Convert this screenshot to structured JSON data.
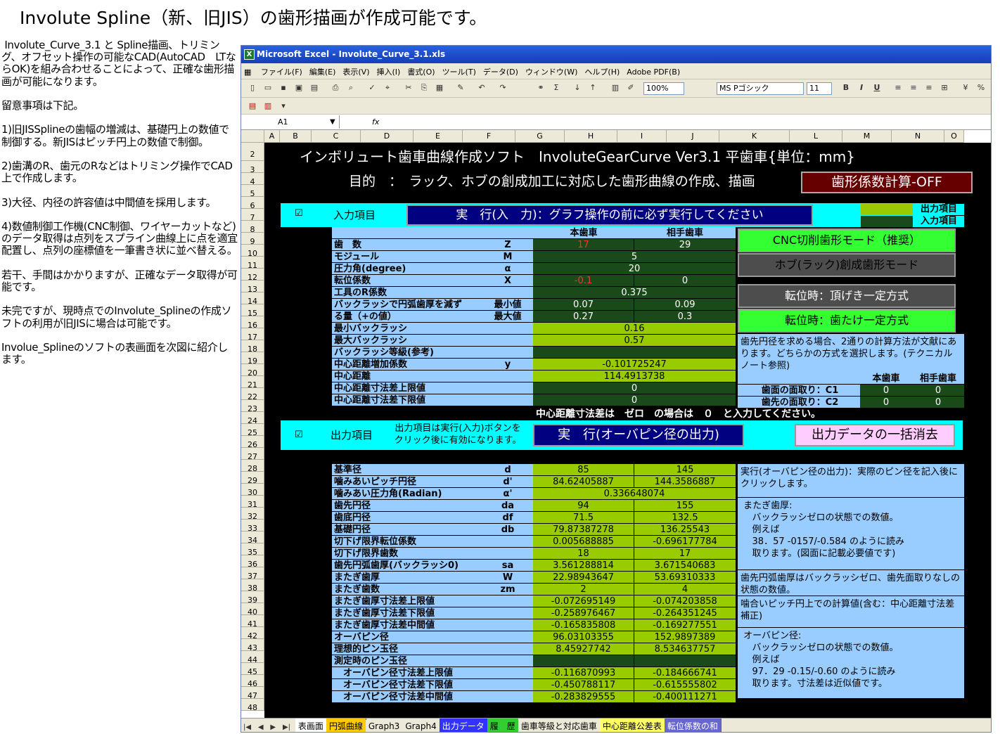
{
  "heading": "Involute Spline（新、旧JIS）の歯形描画が作成可能です。",
  "description": " Involute_Curve_3.1 と Spline描画、トリミング、オフセット操作の可能なCAD(AutoCAD　LTならOK)を組み合わせることによって、正確な歯形描画が可能になります。\n\n留意事項は下記。\n\n1)旧JISSplineの歯幅の増減は、基礎円上の数値で制御する。新JISはピッチ円上の数値で制御。\n\n2)歯溝のR、歯元のRなどはトリミング操作でCAD上で作成します。\n\n3)大径、内径の許容値は中間値を採用します。\n\n4)数値制御工作機(CNC制御、ワイヤーカットなど)のデータ取得は点列をスプライン曲線上に点を適宜配置し、点列の座標値を一筆書き状に並べ替える。\n\n若干、手間はかかりますが、正確なデータ取得が可能です。\n\n未完ですが、現時点でのInvolute_Splineの作成ソフトの利用が旧JISに場合は可能です。\n\nInvolue_Splineのソフトの表画面を次図に紹介します。",
  "window": {
    "title": "Microsoft Excel - Involute_Curve_3.1.xls",
    "menu": [
      "ファイル(F)",
      "編集(E)",
      "表示(V)",
      "挿入(I)",
      "書式(O)",
      "ツール(T)",
      "データ(D)",
      "ウィンドウ(W)",
      "ヘルプ(H)",
      "Adobe PDF(B)"
    ],
    "zoom": "100%",
    "font_name": "MS Pゴシック",
    "font_size": "11",
    "name_box": "A1",
    "fx": "fx"
  },
  "columns": [
    "A",
    "B",
    "C",
    "D",
    "E",
    "F",
    "G",
    "H",
    "I",
    "J",
    "K",
    "L",
    "M",
    "N",
    "O"
  ],
  "rows": [
    "2",
    "3",
    "4",
    "5",
    "6",
    "7",
    "8",
    "9",
    "10",
    "11",
    "12",
    "13",
    "14",
    "15",
    "16",
    "17",
    "18",
    "19",
    "20",
    "21",
    "22",
    "23",
    "24",
    "25",
    "26",
    "27",
    "28",
    "29",
    "30",
    "31",
    "32",
    "33",
    "34",
    "35",
    "36",
    "37",
    "38",
    "39",
    "40",
    "41",
    "42",
    "43",
    "44",
    "45",
    "46",
    "47",
    "48"
  ],
  "sheet": {
    "software_title": "インボリュート歯車曲線作成ソフト　InvoluteGearCurve Ver3.1 平歯車{単位：mm}",
    "purpose": "目的　：　ラック、ホブの創成加工に対応した歯形曲線の作成、描画",
    "coef_button": "歯形係数計算-OFF",
    "input_check": "☑",
    "input_label": "入力項目",
    "run_input_button": "実　行(入　力)：グラフ操作の前に必ず実行してください",
    "legend_output": "出力項目",
    "legend_input": "入力項目",
    "col_main": "本歯車",
    "col_mate": "相手歯車",
    "input_rows": [
      {
        "label": "歯　数",
        "sym": "Z",
        "v1": "17",
        "v2": "29",
        "red1": true
      },
      {
        "label": "モジュール",
        "sym": "M",
        "span": "5"
      },
      {
        "label": "圧力角(degree)",
        "sym": "α",
        "span": "20"
      },
      {
        "label": "転位係数",
        "sym": "X",
        "v1": "-0.1",
        "v2": "0",
        "red1": true
      },
      {
        "label": "工具のR係数",
        "sym": "",
        "span": "0.375"
      },
      {
        "label": "バックラッシで円弧歯厚を減ず",
        "sym": "最小値",
        "v1": "0.07",
        "v2": "0.09"
      },
      {
        "label": "る量（+の値）",
        "sym": "最大値",
        "v1": "0.27",
        "v2": "0.3"
      },
      {
        "label": "最小バックラッシ",
        "sym": "",
        "span": "0.16",
        "light": true
      },
      {
        "label": "最大バックラッシ",
        "sym": "",
        "span": "0.57",
        "light": true
      },
      {
        "label": "バックラッシ等級(参考)",
        "sym": "",
        "span": ""
      },
      {
        "label": "中心距離増加係数",
        "sym": "y",
        "span": "-0.101725247",
        "light": true
      },
      {
        "label": "中心距離",
        "sym": "",
        "span": "114.4913738",
        "light": true
      },
      {
        "label": "中心距離寸法差上限値",
        "sym": "",
        "span": "0"
      },
      {
        "label": "中心距離寸法差下限値",
        "sym": "",
        "span": "0"
      }
    ],
    "mode_buttons": [
      "CNC切削歯形モード（推奨）",
      "ホブ(ラック)創成歯形モード",
      "転位時：頂げき一定方式",
      "転位時：歯たけ一定方式"
    ],
    "method_note": "歯先円径を求める場合、2通りの計算方法が文献にあります。どちらかの方式を選択します。(テクニカルノート参照)",
    "chamfer_head_main": "本歯車",
    "chamfer_head_mate": "相手歯車",
    "chamfer_rows": [
      {
        "label": "歯面の面取り：C1",
        "v1": "0",
        "v2": "0"
      },
      {
        "label": "歯先の面取り：C2",
        "v1": "0",
        "v2": "0"
      }
    ],
    "center_note": "中心距離寸法差は　ゼロ　の場合は　０　と入力してください。",
    "output_check": "☑",
    "output_label": "出力項目",
    "output_hint": "出力項目は実行(入力)ボタンを\nクリック後に有効になります。",
    "run_output_button": "実　行(オーバピン径の出力)",
    "clear_button": "出力データの一括消去",
    "output_rows": [
      {
        "label": "基準径",
        "sym": "d",
        "v1": "85",
        "v2": "145"
      },
      {
        "label": "噛みあいピッチ円径",
        "sym": "d'",
        "v1": "84.62405887",
        "v2": "144.3586887"
      },
      {
        "label": "噛みあい圧力角(Radian)",
        "sym": "α'",
        "span": "0.336648074"
      },
      {
        "label": "歯先円径",
        "sym": "da",
        "v1": "94",
        "v2": "155"
      },
      {
        "label": "歯底円径",
        "sym": "df",
        "v1": "71.5",
        "v2": "132.5"
      },
      {
        "label": "基礎円径",
        "sym": "db",
        "v1": "79.87387278",
        "v2": "136.25543"
      },
      {
        "label": "切下げ限界転位係数",
        "sym": "",
        "v1": "0.005688885",
        "v2": "-0.696177784"
      },
      {
        "label": "切下げ限界歯数",
        "sym": "",
        "v1": "18",
        "v2": "17"
      },
      {
        "label": "歯先円弧歯厚(バックラッシ0)",
        "sym": "sa",
        "v1": "3.561288814",
        "v2": "3.671540683"
      },
      {
        "label": "またぎ歯厚",
        "sym": "W",
        "v1": "22.98943647",
        "v2": "53.69310333"
      },
      {
        "label": "またぎ歯数",
        "sym": "zm",
        "v1": "2",
        "v2": "4"
      },
      {
        "label": "またぎ歯厚寸法差上限値",
        "sym": "",
        "v1": "-0.072695149",
        "v2": "-0.074203858"
      },
      {
        "label": "またぎ歯厚寸法差下限値",
        "sym": "",
        "v1": "-0.258976467",
        "v2": "-0.264351245"
      },
      {
        "label": "またぎ歯厚寸法差中間値",
        "sym": "",
        "v1": "-0.165835808",
        "v2": "-0.169277551"
      },
      {
        "label": "オーバピン径",
        "sym": "",
        "v1": "96.03103355",
        "v2": "152.9897389"
      },
      {
        "label": "理想的ピン玉径",
        "sym": "",
        "v1": "8.45927742",
        "v2": "8.534637757"
      },
      {
        "label": "測定時のピン玉径",
        "sym": "",
        "v1": "",
        "v2": ""
      },
      {
        "label": "　オーバピン径寸法差上限値",
        "sym": "",
        "v1": "-0.116870993",
        "v2": "-0.184666741"
      },
      {
        "label": "　オーバピン径寸法差下限値",
        "sym": "",
        "v1": "-0.450788117",
        "v2": "-0.615555802"
      },
      {
        "label": "　オーバピン径寸法差中間値",
        "sym": "",
        "v1": "-0.283829555",
        "v2": "-0.400111271"
      }
    ],
    "notes": [
      "実行(オーバピン径の出力)：実際のピン径を記入後にクリックします。",
      " またぎ歯厚:\n    バックラッシゼロの状態での数値。\n    例えば\n    38．57 -0157/-0.584 のように読み\n    取ります。(図面に記載必要値です)",
      "歯先円弧歯厚はバックラッシゼロ、歯先面取りなしの状態の数値。",
      "噛合いピッチ円上での計算値(含む：中心距離寸法差補正)",
      " オーバピン径:\n    バックラッシゼロの状態での数値。\n    例えば\n    97．29 -0.15/-0.60 のように読み\n    取ります。寸法差は近似値です。"
    ]
  },
  "sheet_tabs": [
    {
      "label": "表画面",
      "color": "#ffffff"
    },
    {
      "label": "円弧曲線",
      "color": "#ffcc00"
    },
    {
      "label": "Graph3",
      "color": "#ece9d8"
    },
    {
      "label": "Graph4",
      "color": "#ece9d8"
    },
    {
      "label": "出力データ",
      "color": "#3333ff"
    },
    {
      "label": "履　歴",
      "color": "#33cc33"
    },
    {
      "label": "歯車等級と対応歯車",
      "color": "#ece9d8"
    },
    {
      "label": "中心距離公差表",
      "color": "#ffff66"
    },
    {
      "label": "転位係数の和",
      "color": "#6666cc"
    }
  ],
  "colors": {
    "input_bg": "#00ffff",
    "btn_navy": "#000080",
    "btn_green": "#33ff33",
    "btn_gray": "#4d4d4d",
    "btn_red": "#660000",
    "btn_pink": "#ffccff",
    "cell_light": "#99ccff",
    "val_dark": "#1a4a1a",
    "val_light": "#99cc00"
  }
}
